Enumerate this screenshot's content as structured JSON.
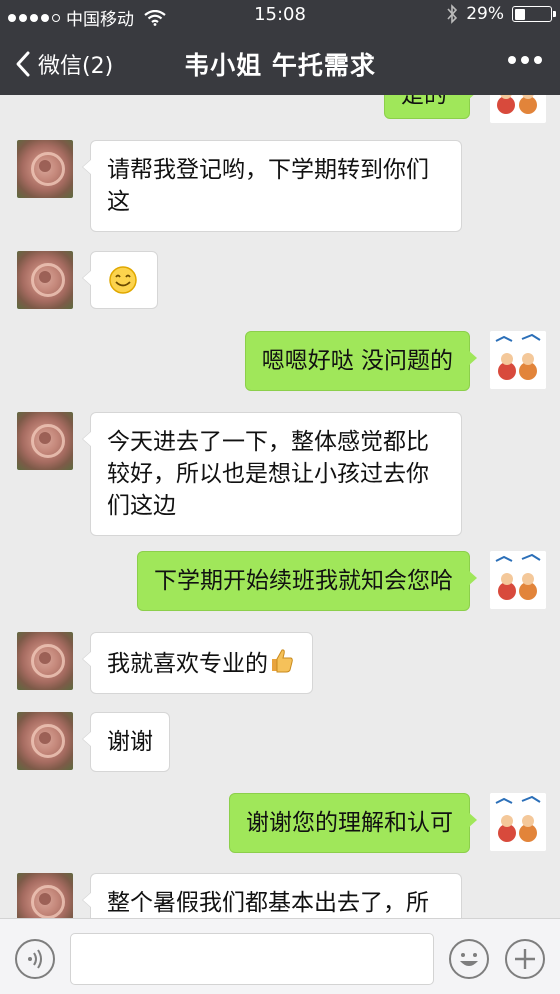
{
  "status_bar": {
    "carrier": "中国移动",
    "time": "15:08",
    "battery": "29%",
    "battery_level": 0.29
  },
  "nav": {
    "back_label": "微信(2)",
    "title": "韦小姐 午托需求"
  },
  "messages": [
    {
      "side": "out",
      "text": "是的"
    },
    {
      "side": "in",
      "text": "请帮我登记哟，下学期转到你们这"
    },
    {
      "side": "in",
      "text": "",
      "emoji": "smile-emoji"
    },
    {
      "side": "out",
      "text": "嗯嗯好哒 没问题的"
    },
    {
      "side": "in",
      "text": "今天进去了一下，整体感觉都比较好，所以也是想让小孩过去你们这边"
    },
    {
      "side": "out",
      "text": "下学期开始续班我就知会您哈"
    },
    {
      "side": "in",
      "text": "我就喜欢专业的",
      "emoji": "thumbs-up-emoji"
    },
    {
      "side": "in",
      "text": "谢谢"
    },
    {
      "side": "out",
      "text": "谢谢您的理解和认可"
    },
    {
      "side": "in",
      "text": "整个暑假我们都基本出去了，所"
    }
  ],
  "input_bar": {
    "icons": [
      "voice-icon",
      "emoji-icon",
      "plus-icon"
    ]
  },
  "colors": {
    "header_bg": "#393a3f",
    "chat_bg": "#ebebeb",
    "outgoing_bubble": "#a0e75a",
    "incoming_bubble": "#ffffff"
  }
}
